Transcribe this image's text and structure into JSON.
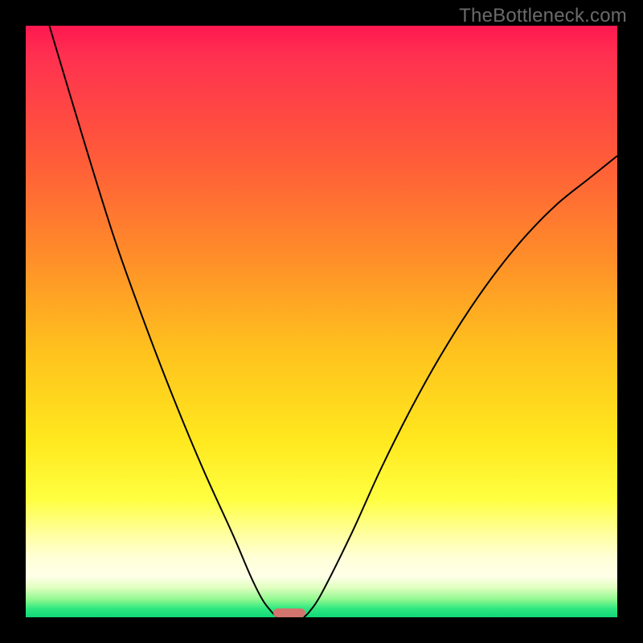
{
  "watermark": "TheBottleneck.com",
  "chart_data": {
    "type": "line",
    "title": "",
    "xlabel": "",
    "ylabel": "",
    "xlim": [
      0,
      100
    ],
    "ylim": [
      0,
      100
    ],
    "background": {
      "type": "vertical-gradient",
      "stops": [
        {
          "pos": 0,
          "color": "#ff1850",
          "meaning": "worst"
        },
        {
          "pos": 50,
          "color": "#ffd020",
          "meaning": "mid"
        },
        {
          "pos": 100,
          "color": "#10d878",
          "meaning": "best"
        }
      ]
    },
    "series": [
      {
        "name": "left-curve",
        "x": [
          4,
          10,
          15,
          20,
          25,
          30,
          35,
          38,
          40,
          41.5,
          42.5
        ],
        "y": [
          100,
          80,
          64,
          50,
          37,
          25,
          14,
          7,
          3,
          1,
          0
        ]
      },
      {
        "name": "right-curve",
        "x": [
          47,
          48,
          50,
          55,
          60,
          65,
          70,
          75,
          80,
          85,
          90,
          95,
          100
        ],
        "y": [
          0,
          1,
          4,
          14,
          25,
          35,
          44,
          52,
          59,
          65,
          70,
          74,
          78
        ]
      }
    ],
    "marker": {
      "x": 44.5,
      "y": 0,
      "color": "#d3746e",
      "shape": "pill"
    },
    "frame": {
      "outer": "#000000",
      "inner_border": 32
    }
  }
}
